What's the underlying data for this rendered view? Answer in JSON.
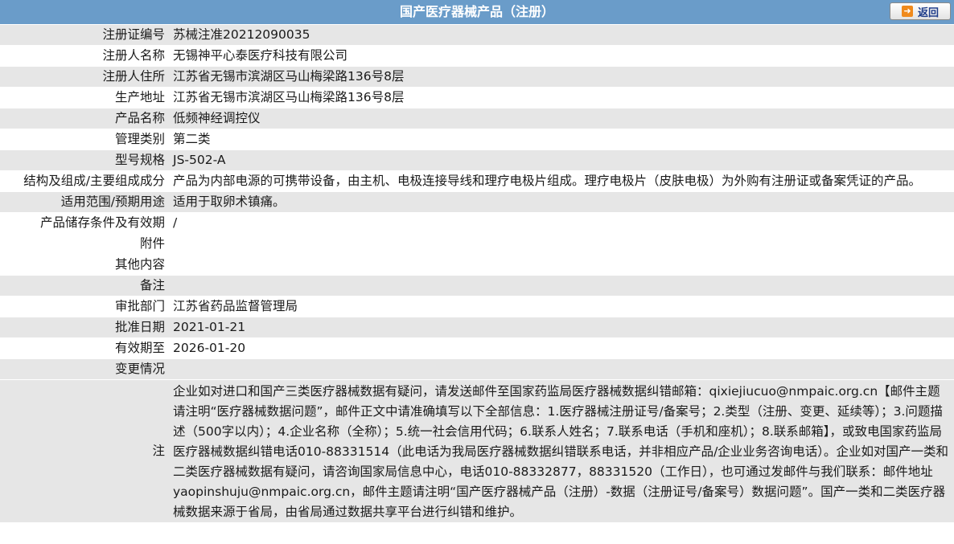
{
  "header": {
    "title": "国产医疗器械产品（注册）",
    "back_label": "返回"
  },
  "rows": [
    {
      "label": "注册证编号",
      "value": "苏械注准20212090035"
    },
    {
      "label": "注册人名称",
      "value": "无锡神平心泰医疗科技有限公司"
    },
    {
      "label": "注册人住所",
      "value": "江苏省无锡市滨湖区马山梅梁路136号8层"
    },
    {
      "label": "生产地址",
      "value": "江苏省无锡市滨湖区马山梅梁路136号8层"
    },
    {
      "label": "产品名称",
      "value": "低频神经调控仪"
    },
    {
      "label": "管理类别",
      "value": "第二类"
    },
    {
      "label": "型号规格",
      "value": "JS-502-A"
    },
    {
      "label": "结构及组成/主要组成成分",
      "value": "产品为内部电源的可携带设备，由主机、电极连接导线和理疗电极片组成。理疗电极片（皮肤电极）为外购有注册证或备案凭证的产品。"
    },
    {
      "label": "适用范围/预期用途",
      "value": "适用于取卵术镇痛。"
    },
    {
      "label": "产品储存条件及有效期",
      "value": "/"
    },
    {
      "label": "附件",
      "value": ""
    },
    {
      "label": "其他内容",
      "value": ""
    },
    {
      "label": "备注",
      "value": ""
    },
    {
      "label": "审批部门",
      "value": "江苏省药品监督管理局"
    },
    {
      "label": "批准日期",
      "value": "2021-01-21"
    },
    {
      "label": "有效期至",
      "value": "2026-01-20"
    },
    {
      "label": "变更情况",
      "value": ""
    }
  ],
  "note": {
    "label": "注",
    "text": "企业如对进口和国产三类医疗器械数据有疑问，请发送邮件至国家药监局医疗器械数据纠错邮箱：qixiejiucuo@nmpaic.org.cn【邮件主题请注明“医疗器械数据问题”，邮件正文中请准确填写以下全部信息：1.医疗器械注册证号/备案号；2.类型（注册、变更、延续等）；3.问题描述（500字以内）；4.企业名称（全称）；5.统一社会信用代码；6.联系人姓名；7.联系电话（手机和座机）；8.联系邮箱】，或致电国家药监局医疗器械数据纠错电话010-88331514（此电话为我局医疗器械数据纠错联系电话，并非相应产品/企业业务咨询电话）。企业如对国产一类和二类医疗器械数据有疑问，请咨询国家局信息中心，电话010-88332877，88331520（工作日），也可通过发邮件与我们联系：邮件地址yaopinshuju@nmpaic.org.cn，邮件主题请注明“国产医疗器械产品（注册）-数据（注册证号/备案号）数据问题”。国产一类和二类医疗器械数据来源于省局，由省局通过数据共享平台进行纠错和维护。"
  }
}
